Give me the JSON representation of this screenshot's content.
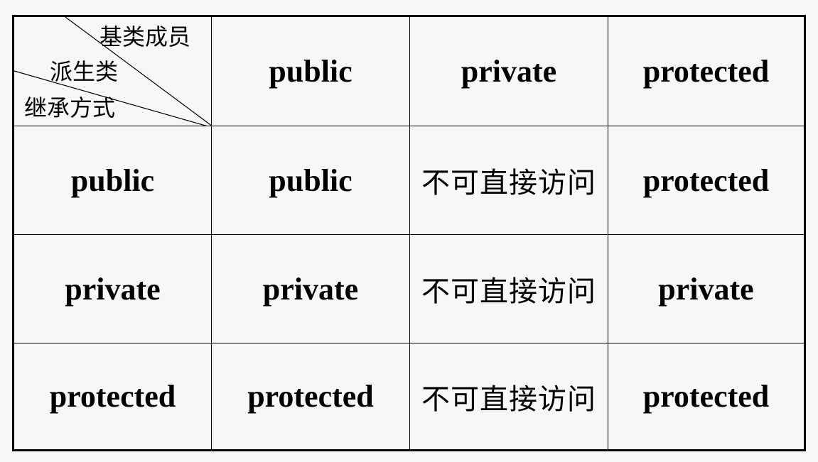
{
  "table": {
    "corner": {
      "base_member_label": "基类成员",
      "derived_label": "派生类",
      "inheritance_label": "继承方式"
    },
    "header": [
      "public",
      "private",
      "protected"
    ],
    "rows": [
      {
        "inheritance": "public",
        "cells": [
          "public",
          "不可直接访问",
          "protected"
        ]
      },
      {
        "inheritance": "private",
        "cells": [
          "private",
          "不可直接访问",
          "private"
        ]
      },
      {
        "inheritance": "protected",
        "cells": [
          "protected",
          "不可直接访问",
          "protected"
        ]
      }
    ]
  }
}
